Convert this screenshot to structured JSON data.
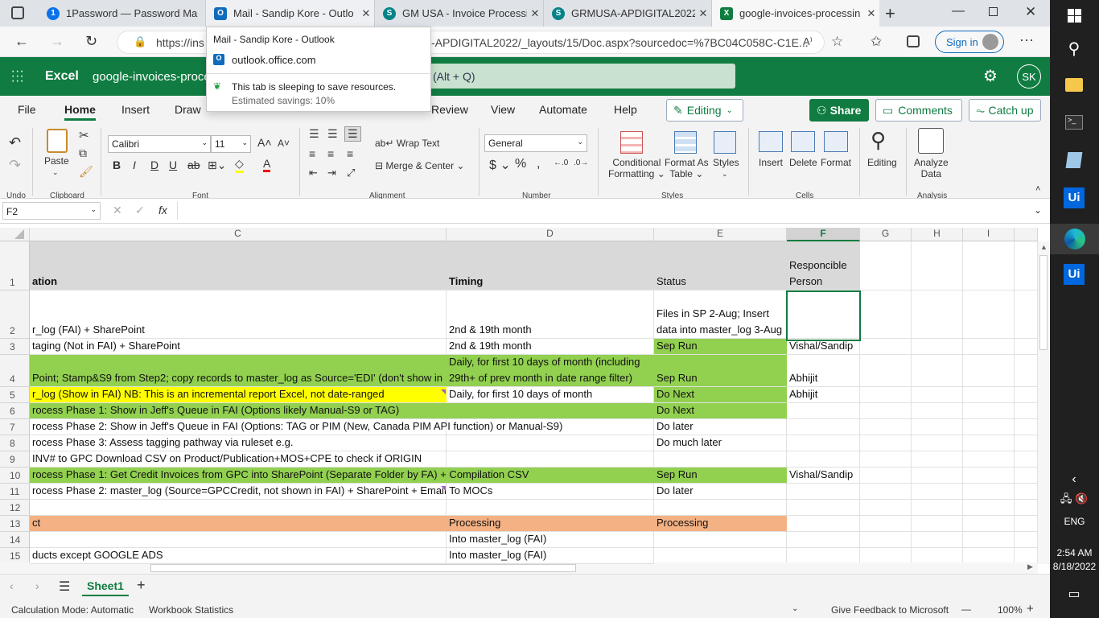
{
  "browser": {
    "tabs": [
      {
        "title": "1Password — Password Ma",
        "icon": "1password-icon",
        "color": "#0a72e8",
        "glyph": "1"
      },
      {
        "title": "Mail - Sandip Kore - Outlo",
        "icon": "outlook-icon",
        "color": "#0f6cbd",
        "glyph": "O"
      },
      {
        "title": "GM USA - Invoice Processi",
        "icon": "sharepoint-icon",
        "color": "#038387",
        "glyph": "S"
      },
      {
        "title": "GRMUSA-APDIGITAL2022 -",
        "icon": "sharepoint-icon",
        "color": "#038387",
        "glyph": "S"
      },
      {
        "title": "google-invoices-processin",
        "icon": "excel-icon",
        "color": "#107c41",
        "glyph": "X"
      }
    ],
    "url_left": "https://ins",
    "url_right": "-APDIGITAL2022/_layouts/15/Doc.aspx?sourcedoc=%7BC04C058C-C1E...",
    "sign_in": "Sign in",
    "popover": {
      "title": "Mail - Sandip Kore - Outlook",
      "domain": "outlook.office.com",
      "sleep_msg": "This tab is sleeping to save resources.",
      "savings": "Estimated savings: 10%"
    }
  },
  "excel": {
    "app_name": "Excel",
    "file_name": "google-invoices-proce",
    "search_hint": "(Alt + Q)",
    "avatar": "SK",
    "menu": [
      "File",
      "Home",
      "Insert",
      "Draw",
      "Review",
      "View",
      "Automate",
      "Help"
    ],
    "editing": "Editing",
    "share": "Share",
    "comments": "Comments",
    "catch_up": "Catch up",
    "ribbon": {
      "undo": "Undo",
      "clipboard": "Clipboard",
      "paste": "Paste",
      "font_name": "Calibri",
      "font_size": "11",
      "font": "Font",
      "wrap_text": "Wrap Text",
      "merge_center": "Merge & Center",
      "alignment": "Alignment",
      "number_format": "General",
      "number": "Number",
      "conditional": "Conditional",
      "formatting": "Formatting",
      "format_as": "Format As",
      "table": "Table",
      "styles_btn": "Styles",
      "styles": "Styles",
      "insert": "Insert",
      "delete": "Delete",
      "format": "Format",
      "cells": "Cells",
      "editing_btn": "Editing",
      "analyze": "Analyze",
      "data": "Data",
      "analysis": "Analysis"
    },
    "name_box": "F2",
    "columns": [
      "C",
      "D",
      "E",
      "F",
      "G",
      "H",
      "I"
    ],
    "rows": [
      {
        "n": "1",
        "c": "ation",
        "d": "Timing",
        "e": "Status",
        "f": "Responcible Person"
      },
      {
        "n": "2",
        "c": "r_log (FAI) + SharePoint",
        "d": "2nd & 19th month",
        "e": "Files in SP 2-Aug; Insert data into master_log 3-Aug",
        "f": ""
      },
      {
        "n": "3",
        "c": "taging (Not in FAI) + SharePoint",
        "d": "2nd & 19th month",
        "e": "Sep Run",
        "f": "Vishal/Sandip"
      },
      {
        "n": "4",
        "c": "Point; Stamp&S9 from Step2; copy records to master_log as Source='EDI' (don't show in",
        "d": "Daily, for first 10 days of month (including 29th+ of prev month in date range filter)",
        "e": "Sep Run",
        "f": "Abhijit"
      },
      {
        "n": "5",
        "c": "r_log (Show in FAI) NB: This is an incremental report Excel, not date-ranged",
        "d": "Daily, for first 10 days of month",
        "e": "Do Next",
        "f": "Abhijit"
      },
      {
        "n": "6",
        "c": "rocess Phase 1: Show in Jeff's Queue in FAI (Options likely Manual-S9 or TAG)",
        "d": "",
        "e": "Do Next",
        "f": ""
      },
      {
        "n": "7",
        "c": "rocess Phase 2: Show in Jeff's Queue in FAI (Options: TAG or PIM (New, Canada PIM API function)  or Manual-S9)",
        "d": "",
        "e": "Do later",
        "f": ""
      },
      {
        "n": "8",
        "c": "rocess Phase 3: Assess tagging pathway via ruleset e.g.",
        "d": "",
        "e": "Do much later",
        "f": ""
      },
      {
        "n": "9",
        "c": " INV# to GPC Download CSV on Product/Publication+MOS+CPE to check if ORIGIN",
        "d": "",
        "e": "",
        "f": ""
      },
      {
        "n": "10",
        "c": "rocess Phase 1: Get Credit Invoices from GPC into SharePoint (Separate Folder by FA) + Compilation CSV",
        "d": "",
        "e": "Sep Run",
        "f": "Vishal/Sandip"
      },
      {
        "n": "11",
        "c": "rocess Phase 2: master_log (Source=GPCCredit, not shown in FAI) + SharePoint + Email To MOCs",
        "d": "",
        "e": "Do later",
        "f": ""
      },
      {
        "n": "12",
        "c": "",
        "d": "",
        "e": "",
        "f": ""
      },
      {
        "n": "13",
        "c": "ct",
        "d": "Processing",
        "e": "Processing",
        "f": ""
      },
      {
        "n": "14",
        "c": "",
        "d": "Into master_log (FAI)",
        "e": "",
        "f": ""
      },
      {
        "n": "15",
        "c": "ducts except GOOGLE ADS",
        "d": "Into master_log (FAI)",
        "e": "",
        "f": ""
      }
    ],
    "sheet_tab": "Sheet1",
    "status": {
      "calc_mode": "Calculation Mode: Automatic",
      "workbook_stats": "Workbook Statistics",
      "feedback": "Give Feedback to Microsoft",
      "zoom": "100%"
    }
  },
  "taskbar": {
    "time": "2:54 AM",
    "date": "8/18/2022",
    "lang": "ENG"
  },
  "colors": {
    "excel_green": "#107c41",
    "row_green": "#92d050",
    "row_yellow": "#ffff00",
    "row_orange": "#f4b183",
    "header_gray": "#d9d9d9"
  }
}
